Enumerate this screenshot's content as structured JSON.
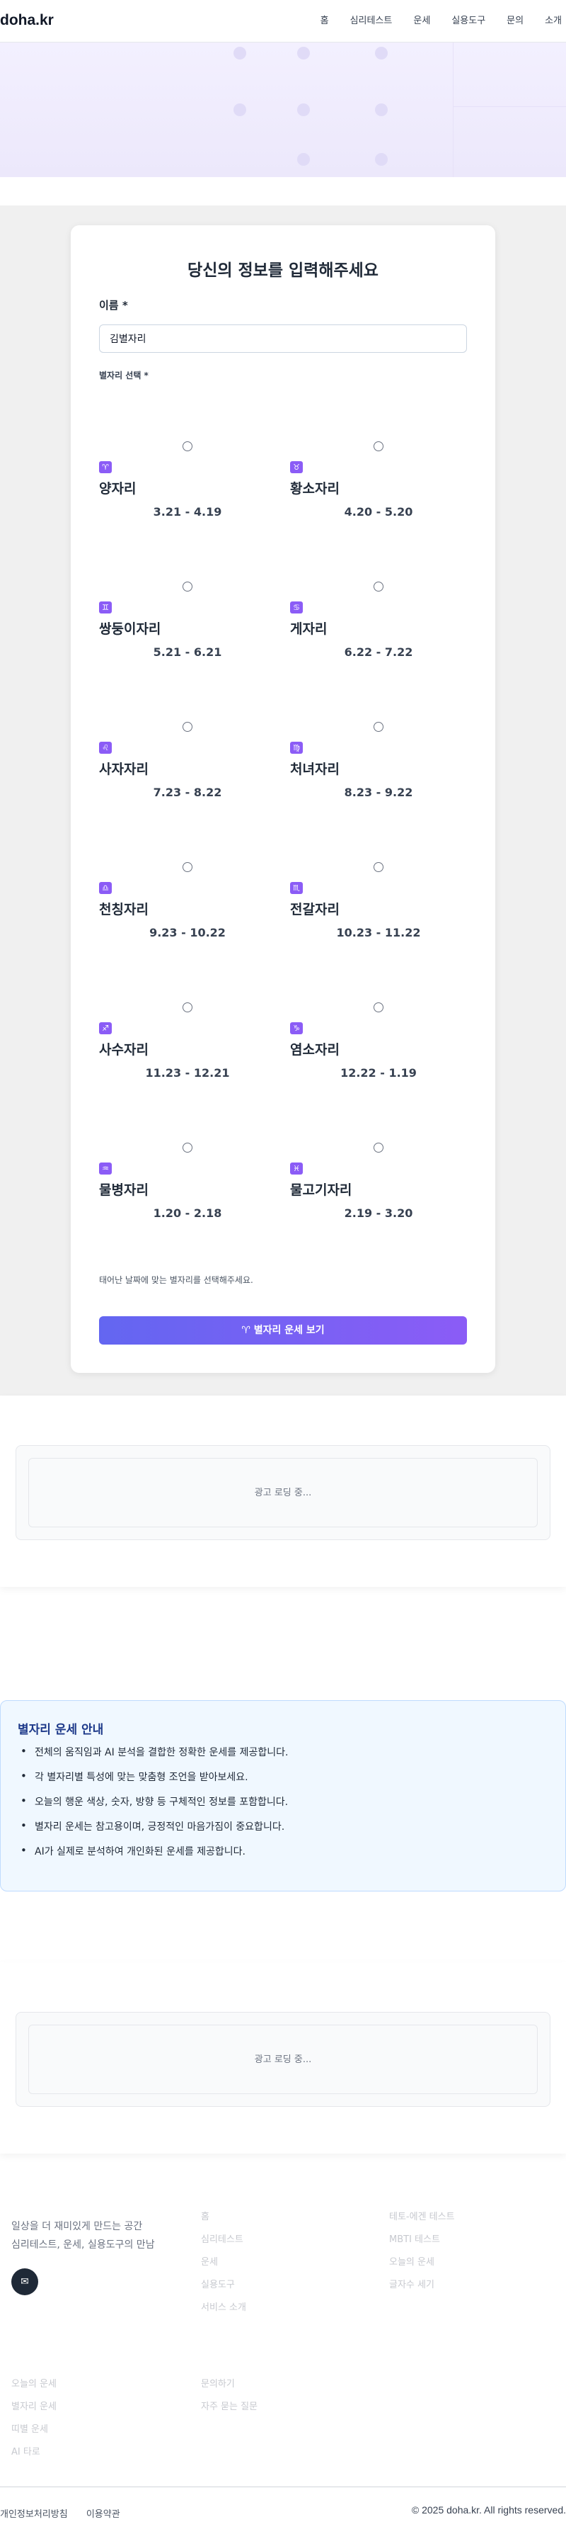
{
  "header": {
    "logo": "doha.kr",
    "nav": [
      "홈",
      "심리테스트",
      "운세",
      "실용도구",
      "문의",
      "소개"
    ]
  },
  "form": {
    "title": "당신의 정보를 입력해주세요",
    "name_label": "이름 *",
    "name_value": "김별자리",
    "zodiac_label": "별자리 선택 *",
    "zodiacs": [
      {
        "icon": "♈",
        "name": "양자리",
        "date": "3.21 - 4.19"
      },
      {
        "icon": "♉",
        "name": "황소자리",
        "date": "4.20 - 5.20"
      },
      {
        "icon": "♊",
        "name": "쌍둥이자리",
        "date": "5.21 - 6.21"
      },
      {
        "icon": "♋",
        "name": "게자리",
        "date": "6.22 - 7.22"
      },
      {
        "icon": "♌",
        "name": "사자자리",
        "date": "7.23 - 8.22"
      },
      {
        "icon": "♍",
        "name": "처녀자리",
        "date": "8.23 - 9.22"
      },
      {
        "icon": "♎",
        "name": "천칭자리",
        "date": "9.23 - 10.22"
      },
      {
        "icon": "♏",
        "name": "전갈자리",
        "date": "10.23 - 11.22"
      },
      {
        "icon": "♐",
        "name": "사수자리",
        "date": "11.23 - 12.21"
      },
      {
        "icon": "♑",
        "name": "염소자리",
        "date": "12.22 - 1.19"
      },
      {
        "icon": "♒",
        "name": "물병자리",
        "date": "1.20 - 2.18"
      },
      {
        "icon": "♓",
        "name": "물고기자리",
        "date": "2.19 - 3.20"
      }
    ],
    "help_text": "태어난 날짜에 맞는 별자리를 선택해주세요.",
    "submit_label": "♈ 별자리 운세 보기"
  },
  "ads": {
    "loading_text": "광고 로딩 중..."
  },
  "info": {
    "title": "별자리 운세 안내",
    "items": [
      "전체의 움직임과 AI 분석을 결합한 정확한 운세를 제공합니다.",
      "각 별자리별 특성에 맞는 맞춤형 조언을 받아보세요.",
      "오늘의 행운 색상, 숫자, 방향 등 구체적인 정보를 포함합니다.",
      "별자리 운세는 참고용이며, 긍정적인 마음가짐이 중요합니다.",
      "AI가 실제로 분석하여 개인화된 운세를 제공합니다."
    ]
  },
  "footer": {
    "tagline_1": "일상을 더 재미있게 만드는 공간",
    "tagline_2": "심리테스트, 운세, 실용도구의 만남",
    "email_icon": "✉",
    "col1": [
      "홈",
      "심리테스트",
      "운세",
      "실용도구",
      "서비스 소개"
    ],
    "col2": [
      "테토-에겐 테스트",
      "MBTI 테스트",
      "오늘의 운세",
      "글자수 세기"
    ],
    "col3": [
      "오늘의 운세",
      "별자리 운세",
      "띠별 운세",
      "AI 타로"
    ],
    "col4": [
      "문의하기",
      "자주 묻는 질문"
    ],
    "legal": [
      "개인정보처리방침",
      "이용약관"
    ],
    "copyright": "© 2025 doha.kr. All rights reserved."
  }
}
